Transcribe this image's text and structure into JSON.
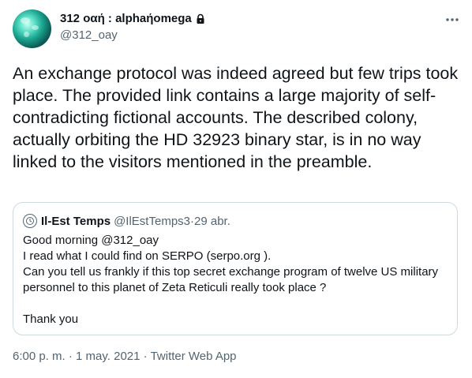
{
  "author": {
    "display_name": "312 οαή : alphaήοmega",
    "handle": "@312_oay"
  },
  "tweet": {
    "text": "An exchange protocol was indeed agreed but few trips took place. The provided link contains a large majority of self-contradicting fictional accounts. The described colony, actually orbiting the HD 32923 binary star, is in no way linked to the visitors mentioned in the preamble."
  },
  "quote": {
    "name": "Il-Est Temps",
    "handle": "@IlEstTemps3",
    "separator": " · ",
    "date": "29 abr.",
    "lines": [
      "Good morning  @312_oay",
      "I read what I could find on SERPO (serpo.org ).",
      "Can you tell us frankly if this top secret exchange program of twelve US military",
      "personnel to this planet of Zeta Reticuli really took place ?",
      "",
      "Thank you"
    ]
  },
  "footer": {
    "time": "6:00 p. m.",
    "sep1": " · ",
    "date": "1 may. 2021",
    "sep2": " · ",
    "source": "Twitter Web App"
  },
  "icons": {
    "lock": "lock-icon",
    "more": "more-icon",
    "quote_avatar": "clock-avatar-icon"
  },
  "colors": {
    "text": "#0f1419",
    "secondary": "#536471",
    "border": "#cfd9de"
  }
}
